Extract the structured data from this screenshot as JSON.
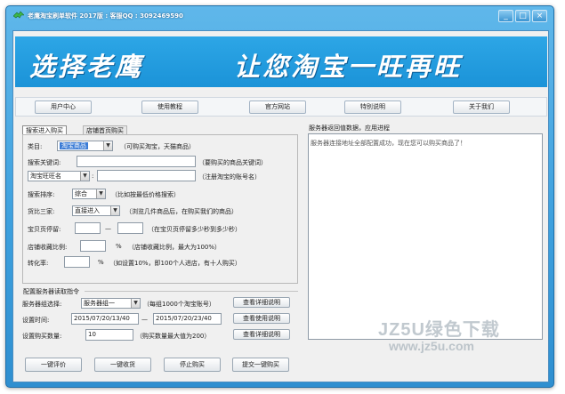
{
  "window": {
    "title": "老鹰淘宝刷单软件 2017版 : 客服QQ : 3092469590",
    "controls": [
      "_",
      "□",
      "×"
    ]
  },
  "banner": {
    "slogan_left": "选择老鹰",
    "slogan_right": "让您淘宝一旺再旺"
  },
  "nav": {
    "items": [
      "用户中心",
      "使用教程",
      "官方网站",
      "特别说明",
      "关于我们"
    ]
  },
  "tabs": {
    "active": "搜索进入购买",
    "inactive": "店铺首页购买"
  },
  "form": {
    "category_label": "类目:",
    "category_value": "淘宝商品",
    "category_hint": "（可购买淘宝，天猫商品）",
    "keyword_label": "搜索关键词:",
    "keyword_value": "",
    "keyword_hint": "（要购买的商品关键词）",
    "account_type_value": "淘宝旺旺名",
    "account_value": "",
    "account_hint": "（注册淘宝的账号名）",
    "sort_label": "搜索排序:",
    "sort_value": "综合",
    "sort_hint": "（比如按最低价格搜索）",
    "compare_label": "货比三家:",
    "compare_value": "直接进入",
    "compare_hint": "（浏览几件商品后，在购买我们的商品）",
    "stay_label": "宝贝页停留:",
    "stay_from": "",
    "stay_dash": "—",
    "stay_to": "",
    "stay_hint": "（在宝贝页停留多少秒到多少秒）",
    "collect_label": "店铺收藏比例:",
    "collect_value": "",
    "collect_unit": "%",
    "collect_hint": "（店铺收藏比例，最大为100%）",
    "conversion_label": "转化率:",
    "conversion_value": "",
    "conversion_unit": "%",
    "conversion_hint": "（如设置10%，即100个人进店，有十人购买）"
  },
  "server_section": {
    "title": "配置服务器读取指令",
    "group_label": "服务器组选择:",
    "group_value": "服务器组一",
    "group_hint": "（每组1000个淘宝账号）",
    "detail_btn": "查看详细说明",
    "time_label": "设置时间:",
    "time_from": "2015/07/20/13/40",
    "time_dash": "—",
    "time_to": "2015/07/20/23/40",
    "time_btn": "查看使用说明",
    "qty_label": "设置购买数量:",
    "qty_value": "10",
    "qty_hint": "（购买数量最大值为200）",
    "qty_btn": "查看详细说明"
  },
  "actions": [
    "一键评价",
    "一键收货",
    "停止购买",
    "提交一键购买"
  ],
  "log": {
    "title": "服务器返回值数据，应用进程",
    "lines": [
      "服务器连接地址全部配置成功，现在您可以购买商品了！"
    ]
  },
  "watermark": {
    "brand": "JZ5U绿色下载",
    "url": "www.jz5u.com"
  }
}
